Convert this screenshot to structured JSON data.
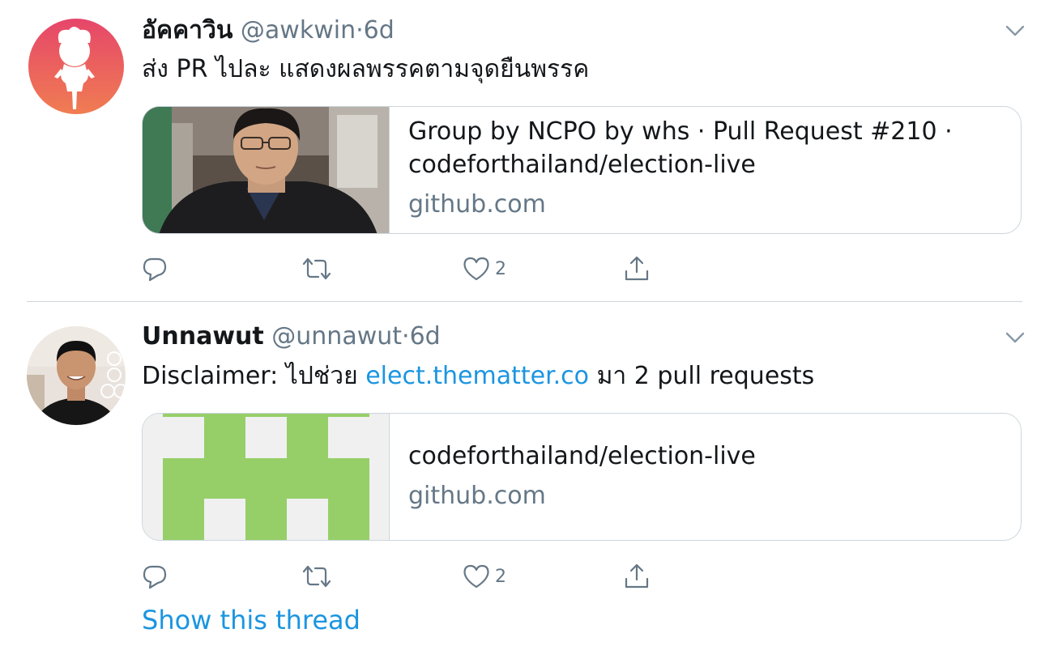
{
  "tweets": [
    {
      "name": "อัคคาวิน",
      "handle": "@awkwin",
      "separator": "·",
      "time": "6d",
      "text": "ส่ง PR ไปละ แสดงผลพรรคตามจุดยืนพรรค",
      "avatar_icon": "character-silhouette-avatar",
      "card": {
        "title_line1": "Group by NCPO by whs · Pull Request #210 ·",
        "title_line2": "codeforthailand/election-live",
        "domain": "github.com",
        "thumbnail": "person-photo"
      },
      "actions": {
        "reply_icon": "reply-icon",
        "retweet_icon": "retweet-icon",
        "like_icon": "heart-icon",
        "like_count": "2",
        "share_icon": "share-icon"
      }
    },
    {
      "name": "Unnawut",
      "handle": "@unnawut",
      "separator": "·",
      "time": "6d",
      "text_before": "Disclaimer: ไปช่วย ",
      "text_link": "elect.thematter.co",
      "text_after": " มา 2 pull requests",
      "avatar_icon": "person-photo-avatar",
      "card": {
        "title_line1": "codeforthailand/election-live",
        "domain": "github.com",
        "thumbnail": "green-identicon"
      },
      "actions": {
        "reply_icon": "reply-icon",
        "retweet_icon": "retweet-icon",
        "like_icon": "heart-icon",
        "like_count": "2",
        "share_icon": "share-icon"
      }
    }
  ],
  "show_thread": "Show this thread",
  "colors": {
    "text_primary": "#14171a",
    "text_secondary": "#657786",
    "link": "#1b95e0",
    "border": "#ccd6dd",
    "identicon_green": "#96cf68",
    "identicon_bg": "#f0f0f0",
    "avatar_gradient_top": "#e6466a",
    "avatar_gradient_bottom": "#f08050"
  }
}
